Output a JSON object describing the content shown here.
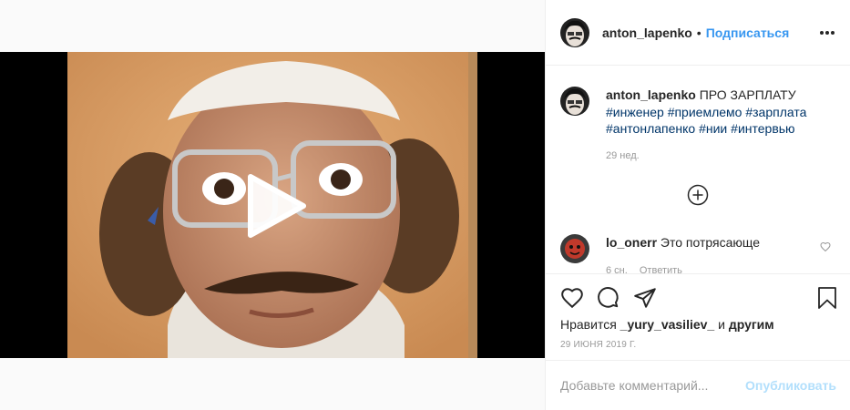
{
  "post": {
    "author": "anton_lapenko",
    "separator": "•",
    "follow_label": "Подписаться",
    "more_icon": "more-options-icon"
  },
  "caption": {
    "username": "anton_lapenko",
    "title": "ПРО ЗАРПЛАТУ",
    "hashtags": [
      "#инженер",
      "#приемлемо",
      "#зарплата",
      "#антонлапенко",
      "#нии",
      "#интервью"
    ],
    "age": "29 нед."
  },
  "comments": [
    {
      "username": "lo_onerr",
      "text": "Это потрясающе",
      "age": "6 сн.",
      "reply_label": "Ответить"
    }
  ],
  "likes": {
    "prefix": "Нравится",
    "user": "_yury_vasiliev_",
    "conj": "и",
    "others": "другим"
  },
  "date": "29 ИЮНЯ 2019 Г.",
  "add_comment": {
    "placeholder": "Добавьте комментарий...",
    "publish_label": "Опубликовать"
  },
  "colors": {
    "link_blue": "#3897f0",
    "hashtag": "#003569",
    "publish_disabled": "#b2dffc",
    "muted": "#999999"
  }
}
